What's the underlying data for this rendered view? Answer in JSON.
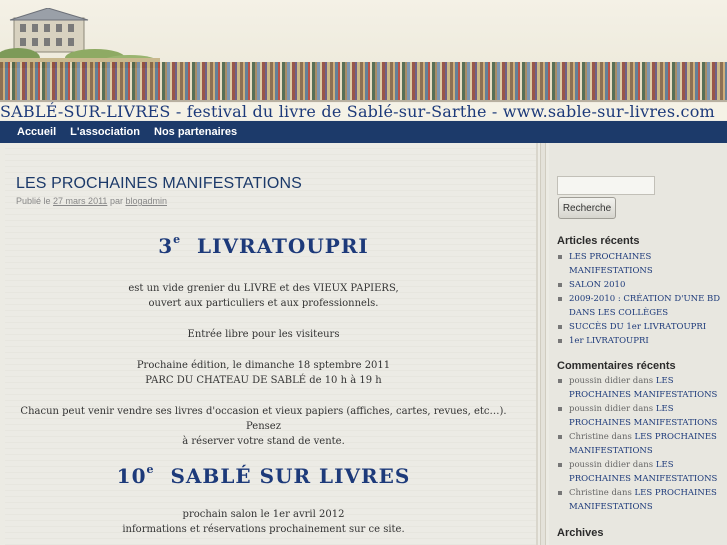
{
  "header": {
    "banner": "SABLÉ-SUR-LIVRES - festival du livre de Sablé-sur-Sarthe - www.sable-sur-livres.com"
  },
  "nav": {
    "items": [
      "Accueil",
      "L'association",
      "Nos partenaires"
    ]
  },
  "post": {
    "title": "LES PROCHAINES MANIFESTATIONS",
    "meta_prefix": "Publié le",
    "date": "27 mars 2011",
    "meta_by": "par",
    "author": "blogadmin",
    "head1_num": "3",
    "head1_sup": "e",
    "head1_text": "LIVRATOUPRI",
    "p1_line1": "est un vide grenier du LIVRE et des VIEUX PAPIERS,",
    "p1_line2": "ouvert aux particuliers et aux professionnels.",
    "p2": "Entrée libre pour les visiteurs",
    "p3_line1": "Prochaine édition, le dimanche 18 sptembre 2011",
    "p3_line2": "PARC DU CHATEAU DE SABLÉ de 10 h à 19 h",
    "p4_line1": "Chacun peut venir vendre ses livres d'occasion et vieux papiers (affiches, cartes, revues, etc…). Pensez",
    "p4_line2": "à réserver votre stand de vente.",
    "head2_num": "10",
    "head2_sup": "e",
    "head2_text": "SABLÉ SUR LIVRES",
    "p5_line1": "prochain salon le 1er avril 2012",
    "p5_line2": "informations et réservations prochainement sur ce site."
  },
  "sidebar": {
    "search": {
      "placeholder": "",
      "button_label": "Recherche"
    },
    "recent_posts": {
      "title": "Articles récents",
      "items": [
        "LES PROCHAINES MANIFESTATIONS",
        "SALON 2010",
        "2009-2010 : CRÉATION D'UNE BD DANS LES COLLÈGES",
        "SUCCÈS DU 1er LIVRATOUPRI",
        "1er LIVRATOUPRI"
      ]
    },
    "recent_comments": {
      "title": "Commentaires récents",
      "in_word": "dans",
      "items": [
        {
          "who": "poussin didier",
          "post": "LES PROCHAINES MANIFESTATIONS"
        },
        {
          "who": "poussin didier",
          "post": "LES PROCHAINES MANIFESTATIONS"
        },
        {
          "who": "Christine",
          "post": "LES PROCHAINES MANIFESTATIONS"
        },
        {
          "who": "poussin didier",
          "post": "LES PROCHAINES MANIFESTATIONS"
        },
        {
          "who": "Christine",
          "post": "LES PROCHAINES MANIFESTATIONS"
        }
      ]
    },
    "archives": {
      "title": "Archives"
    }
  },
  "colors": {
    "nav_bg": "#1c3a6a",
    "heading_blue": "#1d3a7a",
    "link_blue": "#1d3a7a",
    "page_bg": "#ecebe4"
  }
}
